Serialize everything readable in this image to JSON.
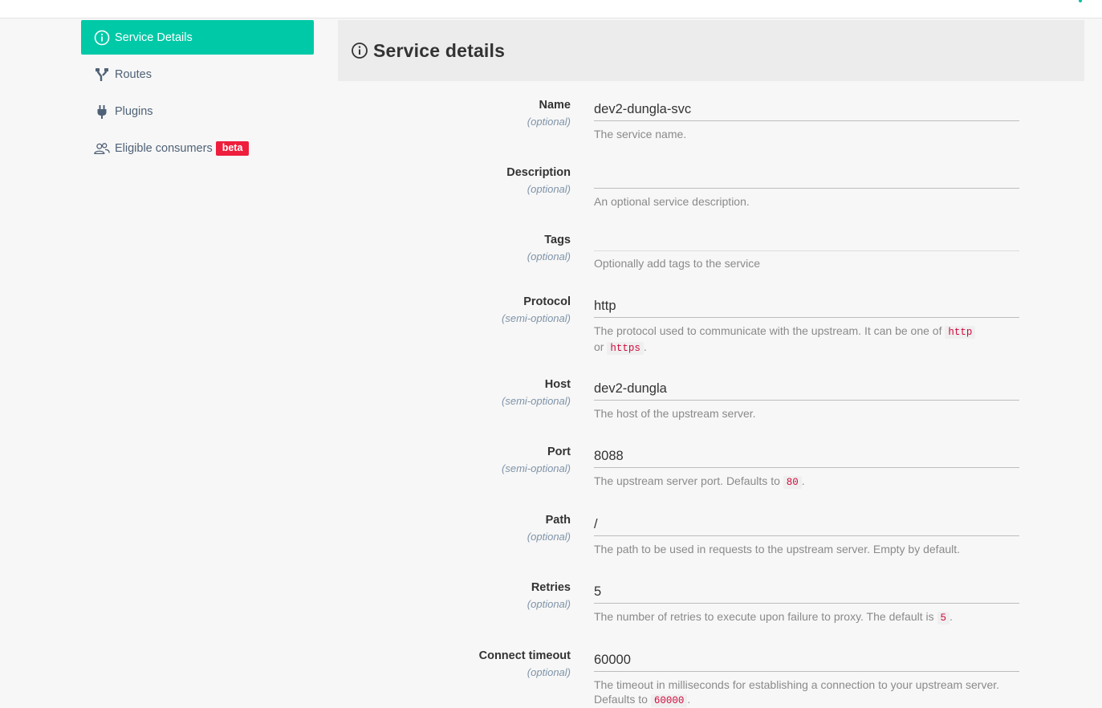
{
  "sidebar": {
    "items": [
      {
        "label": "Service Details",
        "icon": "info-circle-icon",
        "active": true
      },
      {
        "label": "Routes",
        "icon": "routes-icon"
      },
      {
        "label": "Plugins",
        "icon": "plug-icon"
      },
      {
        "label": "Eligible consumers",
        "icon": "users-icon",
        "badge": "beta"
      }
    ]
  },
  "header": {
    "title": "Service details",
    "icon": "info-circle-icon"
  },
  "fields": {
    "name": {
      "label": "Name",
      "sub": "(optional)",
      "value": "dev2-dungla-svc",
      "help": "The service name."
    },
    "description": {
      "label": "Description",
      "sub": "(optional)",
      "value": "",
      "help": "An optional service description."
    },
    "tags": {
      "label": "Tags",
      "sub": "(optional)",
      "value": "",
      "help": "Optionally add tags to the service"
    },
    "protocol": {
      "label": "Protocol",
      "sub": "(semi-optional)",
      "value": "http",
      "help_pre": "The protocol used to communicate with the upstream. It can be one of",
      "code1": "http",
      "help_mid": "or",
      "code2": "https",
      "help_post": "."
    },
    "host": {
      "label": "Host",
      "sub": "(semi-optional)",
      "value": "dev2-dungla",
      "help": "The host of the upstream server."
    },
    "port": {
      "label": "Port",
      "sub": "(semi-optional)",
      "value": "8088",
      "help_pre": "The upstream server port. Defaults to",
      "code": "80",
      "help_post": "."
    },
    "path": {
      "label": "Path",
      "sub": "(optional)",
      "value": "/",
      "help": "The path to be used in requests to the upstream server. Empty by default."
    },
    "retries": {
      "label": "Retries",
      "sub": "(optional)",
      "value": "5",
      "help_pre": "The number of retries to execute upon failure to proxy. The default is",
      "code": "5",
      "help_post": "."
    },
    "connect_timeout": {
      "label": "Connect timeout",
      "sub": "(optional)",
      "value": "60000",
      "help_pre": "The timeout in milliseconds for establishing a connection to your upstream server. Defaults to",
      "code": "60000",
      "help_post": "."
    }
  },
  "colors": {
    "accent": "#00c9a7",
    "badge": "#ee1e3c",
    "code": "#d10a3c"
  }
}
